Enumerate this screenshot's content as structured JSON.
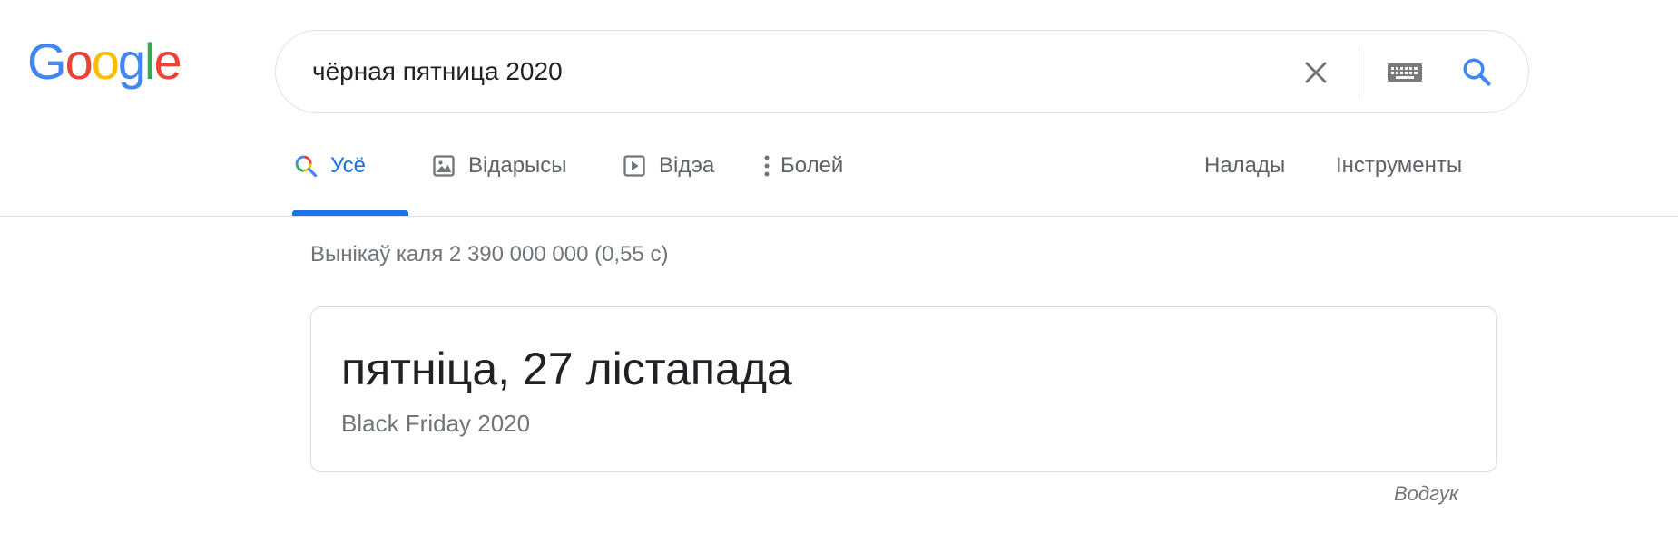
{
  "logo": {
    "letters": [
      "G",
      "o",
      "o",
      "g",
      "l",
      "e"
    ],
    "colors": [
      "#4285f4",
      "#ea4335",
      "#fbbc05",
      "#4285f4",
      "#34a853",
      "#ea4335"
    ]
  },
  "search": {
    "query": "чёрная пятница 2020",
    "clear_icon": "close-icon",
    "keyboard_icon": "keyboard-icon",
    "search_icon": "search-icon"
  },
  "tabs": {
    "all": "Усё",
    "images": "Відарысы",
    "videos": "Відэа",
    "more": "Болей",
    "settings": "Налады",
    "tools": "Інструменты"
  },
  "result_stats": "Вынікаў каля 2 390 000 000 (0,55 с)",
  "answer": {
    "title": "пятніца, 27 лістапада",
    "subtitle": "Black Friday 2020"
  },
  "feedback": "Водгук",
  "colors": {
    "accent": "#1a73e8",
    "text": "#202124",
    "muted": "#70757a",
    "icon_gray": "#70757a"
  }
}
